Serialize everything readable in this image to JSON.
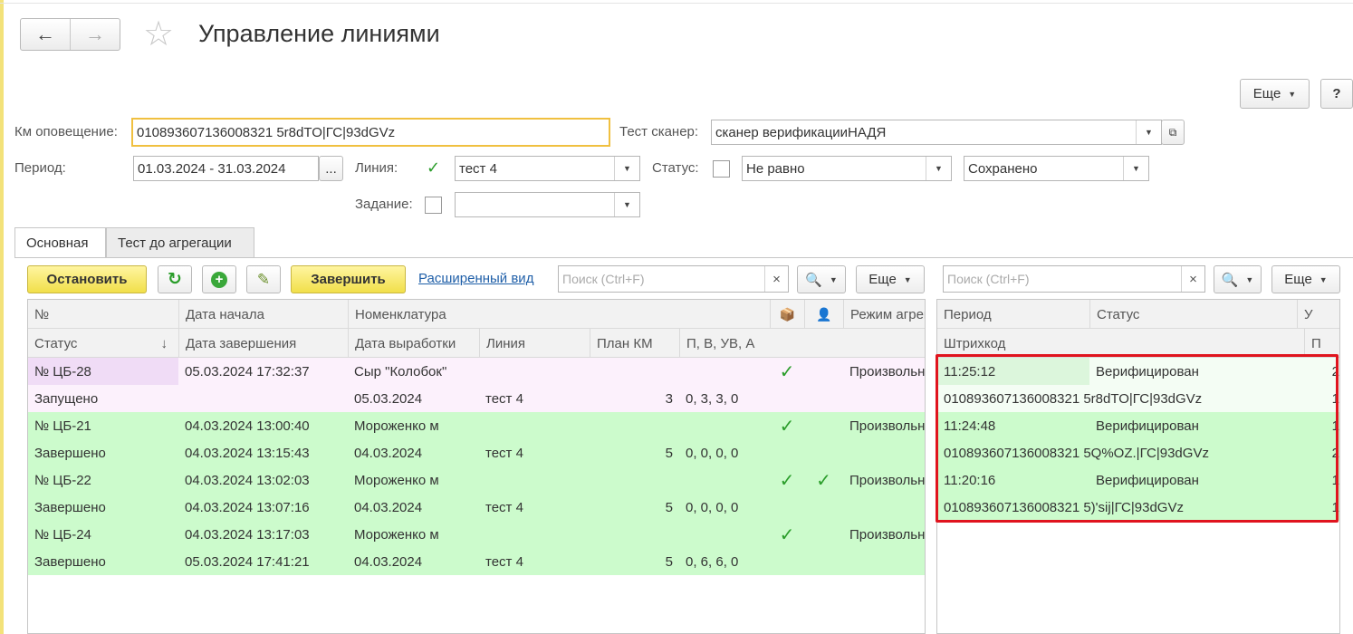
{
  "window": {
    "title": "Управление линиями"
  },
  "nav": {
    "back": "←",
    "forward": "→"
  },
  "topbar": {
    "more_label": "Еще",
    "help_label": "?"
  },
  "filters": {
    "km_label": "Км оповещение:",
    "km_value": "010893607136008321 5r8dTO|ГС|93dGVz",
    "scanner_label": "Тест сканер:",
    "scanner_value": "сканер верификацииНАДЯ",
    "period_label": "Период:",
    "period_value": "01.03.2024 - 31.03.2024",
    "period_button": "...",
    "line_label": "Линия:",
    "line_checked": true,
    "line_value": "тест 4",
    "status_label": "Статус:",
    "status_checked": false,
    "status_op": "Не равно",
    "status_value": "Сохранено",
    "task_label": "Задание:",
    "task_checked": false,
    "task_value": ""
  },
  "tabs": [
    {
      "label": "Основная",
      "active": true
    },
    {
      "label": "Тест до агрегации",
      "active": false
    }
  ],
  "left_toolbar": {
    "stop": "Остановить",
    "finish": "Завершить",
    "extended_view": "Расширенный вид",
    "search_placeholder": "Поиск (Ctrl+F)",
    "search_clear": "×",
    "more": "Еще"
  },
  "left_table": {
    "header_row1": [
      "№",
      "Дата начала",
      "Номенклатура",
      "📦",
      "👤",
      "Режим агрегации"
    ],
    "header_row2": [
      "Статус",
      "Дата завершения",
      "Дата выработки",
      "Линия",
      "План КМ",
      "П, В, УВ, А"
    ],
    "sort_indicator": "↓",
    "rows": [
      {
        "num": "№ ЦБ-28",
        "start": "05.03.2024 17:32:37",
        "nom": "Сыр \"Колобок\"",
        "c1": "✓",
        "c2": "",
        "mode": "Произвольно",
        "status": "Запущено",
        "end": "",
        "prod": "05.03.2024",
        "line": "тест 4",
        "plan": "3",
        "pvuva": "0, 3, 3, 0",
        "color": "#fcf1fc"
      },
      {
        "num": "№ ЦБ-21",
        "start": "04.03.2024 13:00:40",
        "nom": "Мороженко м",
        "c1": "✓",
        "c2": "",
        "mode": "Произвольно",
        "status": "Завершено",
        "end": "04.03.2024 13:15:43",
        "prod": "04.03.2024",
        "line": "тест 4",
        "plan": "5",
        "pvuva": "0, 0, 0, 0",
        "color": "#ccfbcc"
      },
      {
        "num": "№ ЦБ-22",
        "start": "04.03.2024 13:02:03",
        "nom": "Мороженко м",
        "c1": "✓",
        "c2": "✓",
        "mode": "Произвольно",
        "status": "Завершено",
        "end": "04.03.2024 13:07:16",
        "prod": "04.03.2024",
        "line": "тест 4",
        "plan": "5",
        "pvuva": "0, 0, 0, 0",
        "color": "#ccfbcc"
      },
      {
        "num": "№ ЦБ-24",
        "start": "04.03.2024 13:17:03",
        "nom": "Мороженко м",
        "c1": "✓",
        "c2": "",
        "mode": "Произвольно",
        "status": "Завершено",
        "end": "05.03.2024 17:41:21",
        "prod": "04.03.2024",
        "line": "тест 4",
        "plan": "5",
        "pvuva": "0, 6, 6, 0",
        "color": "#ccfbcc"
      }
    ]
  },
  "right_toolbar": {
    "search_placeholder": "Поиск (Ctrl+F)",
    "search_clear": "×",
    "more": "Еще"
  },
  "right_table": {
    "header_row1": [
      "Период",
      "Статус",
      "У"
    ],
    "header_row2": [
      "Штрихкод",
      "П"
    ],
    "rows": [
      {
        "period": "11:25:12",
        "status": "Верифицирован",
        "u": "2",
        "barcode": "010893607136008321 5r8dTO|ГС|93dGVz",
        "p": "1",
        "light": true
      },
      {
        "period": "11:24:48",
        "status": "Верифицирован",
        "u": "1",
        "barcode": "010893607136008321 5Q%OZ.|ГС|93dGVz",
        "p": "2",
        "light": false
      },
      {
        "period": "11:20:16",
        "status": "Верифицирован",
        "u": "1",
        "barcode": "010893607136008321 5)'sij|ГС|93dGVz",
        "p": "1",
        "light": false
      }
    ]
  },
  "colors": {
    "highlight_border": "#e0141e",
    "row_green": "#ccfbcc",
    "row_pink": "#fcf1fc",
    "accent_yellow": "#f1df4a"
  }
}
